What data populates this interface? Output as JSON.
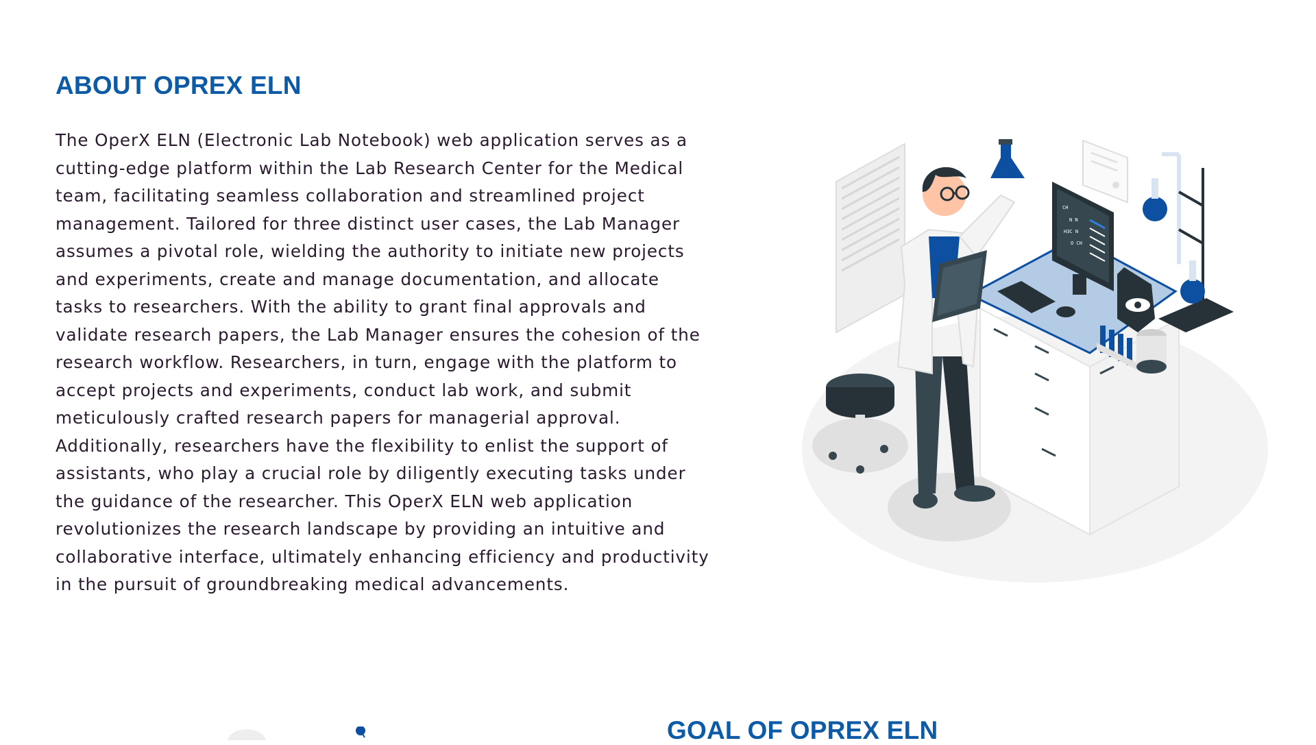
{
  "about": {
    "title": "ABOUT OPREX ELN",
    "lines": [
      "The OperX ELN (Electronic Lab Notebook) web application serves as a",
      "cutting-edge platform within the Lab Research Center for the Medical",
      "team, facilitating seamless collaboration and streamlined project",
      "management. Tailored for three distinct user cases, the Lab Manager",
      "assumes a pivotal role, wielding the authority to initiate new projects",
      "and experiments, create and manage documentation, and allocate",
      "tasks to researchers. With the ability to grant final approvals and",
      "validate research papers, the Lab Manager ensures the cohesion of the",
      "research workflow. Researchers, in turn, engage with the platform to",
      "accept projects and experiments, conduct lab work, and submit",
      "meticulously crafted research papers for managerial approval.",
      "Additionally, researchers have the flexibility to enlist the support of",
      "assistants, who play a crucial role by diligently executing tasks under",
      "the guidance of the researcher. This OperX ELN web application",
      "revolutionizes the research landscape by providing an intuitive and",
      "collaborative interface, ultimately enhancing efficiency and productivity",
      "in the pursuit of groundbreaking medical advancements."
    ],
    "illustration_icon": "lab-researcher-illustration"
  },
  "goal": {
    "title": "GOAL OF OPREX ELN",
    "illustration_icon": "goal-illustration"
  },
  "colors": {
    "accent": "#0d5aa7",
    "body_text": "#2a1a2e",
    "illustration_blue": "#0d4fa0",
    "illustration_dark": "#37474f"
  }
}
